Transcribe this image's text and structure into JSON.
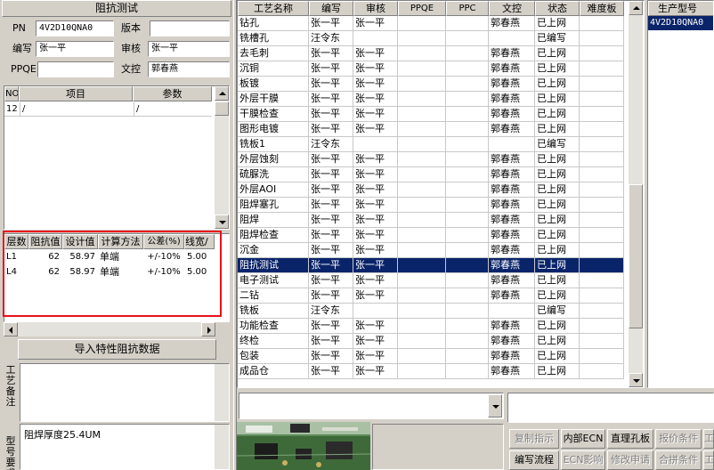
{
  "left": {
    "title": "阻抗测试",
    "pn_label": "PN",
    "pn_value": "4V2D10QNA0",
    "version_label": "版本",
    "version_value": "",
    "writer_label": "编写",
    "writer_value": "张一平",
    "reviewer_label": "审核",
    "reviewer_value": "张一平",
    "ppqe_label": "PPQE",
    "ppqe_value": "",
    "doc_label": "文控",
    "doc_value": "郭春燕",
    "items_table": {
      "headers": [
        "NO",
        "项目",
        "参数"
      ],
      "rows": [
        [
          "12",
          "/",
          "/"
        ]
      ]
    },
    "impedance_table": {
      "headers": [
        "层数",
        "阻抗值",
        "设计值",
        "计算方法",
        "公差(%)",
        "线宽/"
      ],
      "rows": [
        [
          "L1",
          "62",
          "58.97",
          "单端",
          "+/-10%",
          "5.00"
        ],
        [
          "L4",
          "62",
          "58.97",
          "单端",
          "+/-10%",
          "5.00"
        ]
      ]
    },
    "import_button": "导入特性阻抗数据",
    "notes_label": "工艺备注",
    "spec_label": "型号要求",
    "spec_text": "阻焊厚度25.4UM"
  },
  "process": {
    "headers": [
      "工艺名称",
      "编写",
      "审核",
      "PPQE",
      "PPC",
      "文控",
      "状态",
      "难度板"
    ],
    "rows": [
      [
        "钻孔",
        "张一平",
        "张一平",
        "",
        "",
        "郭春燕",
        "已上网",
        ""
      ],
      [
        "铣槽孔",
        "汪令东",
        "",
        "",
        "",
        "",
        "已编写",
        ""
      ],
      [
        "去毛刺",
        "张一平",
        "张一平",
        "",
        "",
        "郭春燕",
        "已上网",
        ""
      ],
      [
        "沉铜",
        "张一平",
        "张一平",
        "",
        "",
        "郭春燕",
        "已上网",
        ""
      ],
      [
        "板镀",
        "张一平",
        "张一平",
        "",
        "",
        "郭春燕",
        "已上网",
        ""
      ],
      [
        "外层干膜",
        "张一平",
        "张一平",
        "",
        "",
        "郭春燕",
        "已上网",
        ""
      ],
      [
        "干膜检查",
        "张一平",
        "张一平",
        "",
        "",
        "郭春燕",
        "已上网",
        ""
      ],
      [
        "图形电镀",
        "张一平",
        "张一平",
        "",
        "",
        "郭春燕",
        "已上网",
        ""
      ],
      [
        "铣板1",
        "汪令东",
        "",
        "",
        "",
        "",
        "已编写",
        ""
      ],
      [
        "外层蚀刻",
        "张一平",
        "张一平",
        "",
        "",
        "郭春燕",
        "已上网",
        ""
      ],
      [
        "硫脲洗",
        "张一平",
        "张一平",
        "",
        "",
        "郭春燕",
        "已上网",
        ""
      ],
      [
        "外层AOI",
        "张一平",
        "张一平",
        "",
        "",
        "郭春燕",
        "已上网",
        ""
      ],
      [
        "阻焊塞孔",
        "张一平",
        "张一平",
        "",
        "",
        "郭春燕",
        "已上网",
        ""
      ],
      [
        "阻焊",
        "张一平",
        "张一平",
        "",
        "",
        "郭春燕",
        "已上网",
        ""
      ],
      [
        "阻焊检查",
        "张一平",
        "张一平",
        "",
        "",
        "郭春燕",
        "已上网",
        ""
      ],
      [
        "沉金",
        "张一平",
        "张一平",
        "",
        "",
        "郭春燕",
        "已上网",
        ""
      ],
      [
        "阻抗测试",
        "张一平",
        "张一平",
        "",
        "",
        "郭春燕",
        "已上网",
        ""
      ],
      [
        "电子测试",
        "张一平",
        "张一平",
        "",
        "",
        "郭春燕",
        "已上网",
        ""
      ],
      [
        "二钻",
        "张一平",
        "张一平",
        "",
        "",
        "郭春燕",
        "已上网",
        ""
      ],
      [
        "铣板",
        "汪令东",
        "",
        "",
        "",
        "",
        "已编写",
        ""
      ],
      [
        "功能检查",
        "张一平",
        "张一平",
        "",
        "",
        "郭春燕",
        "已上网",
        ""
      ],
      [
        "终检",
        "张一平",
        "张一平",
        "",
        "",
        "郭春燕",
        "已上网",
        ""
      ],
      [
        "包装",
        "张一平",
        "张一平",
        "",
        "",
        "郭春燕",
        "已上网",
        ""
      ],
      [
        "成品仓",
        "张一平",
        "张一平",
        "",
        "",
        "郭春燕",
        "已上网",
        ""
      ]
    ],
    "selected_index": 16
  },
  "right": {
    "header": "生产型号",
    "value": "4V2D10QNA0"
  },
  "buttons": {
    "row1": [
      "复制指示",
      "内部ECN",
      "直理孔板",
      "报价条件",
      "工"
    ],
    "row1_enabled": [
      false,
      true,
      true,
      false,
      false
    ],
    "row2": [
      "编写流程",
      "ECN影响",
      "修改申请",
      "合拼条件",
      "工"
    ],
    "row2_enabled": [
      true,
      false,
      false,
      false,
      false
    ]
  },
  "colors": {
    "selection": "#0a246a",
    "highlight_box": "#e8101a"
  }
}
